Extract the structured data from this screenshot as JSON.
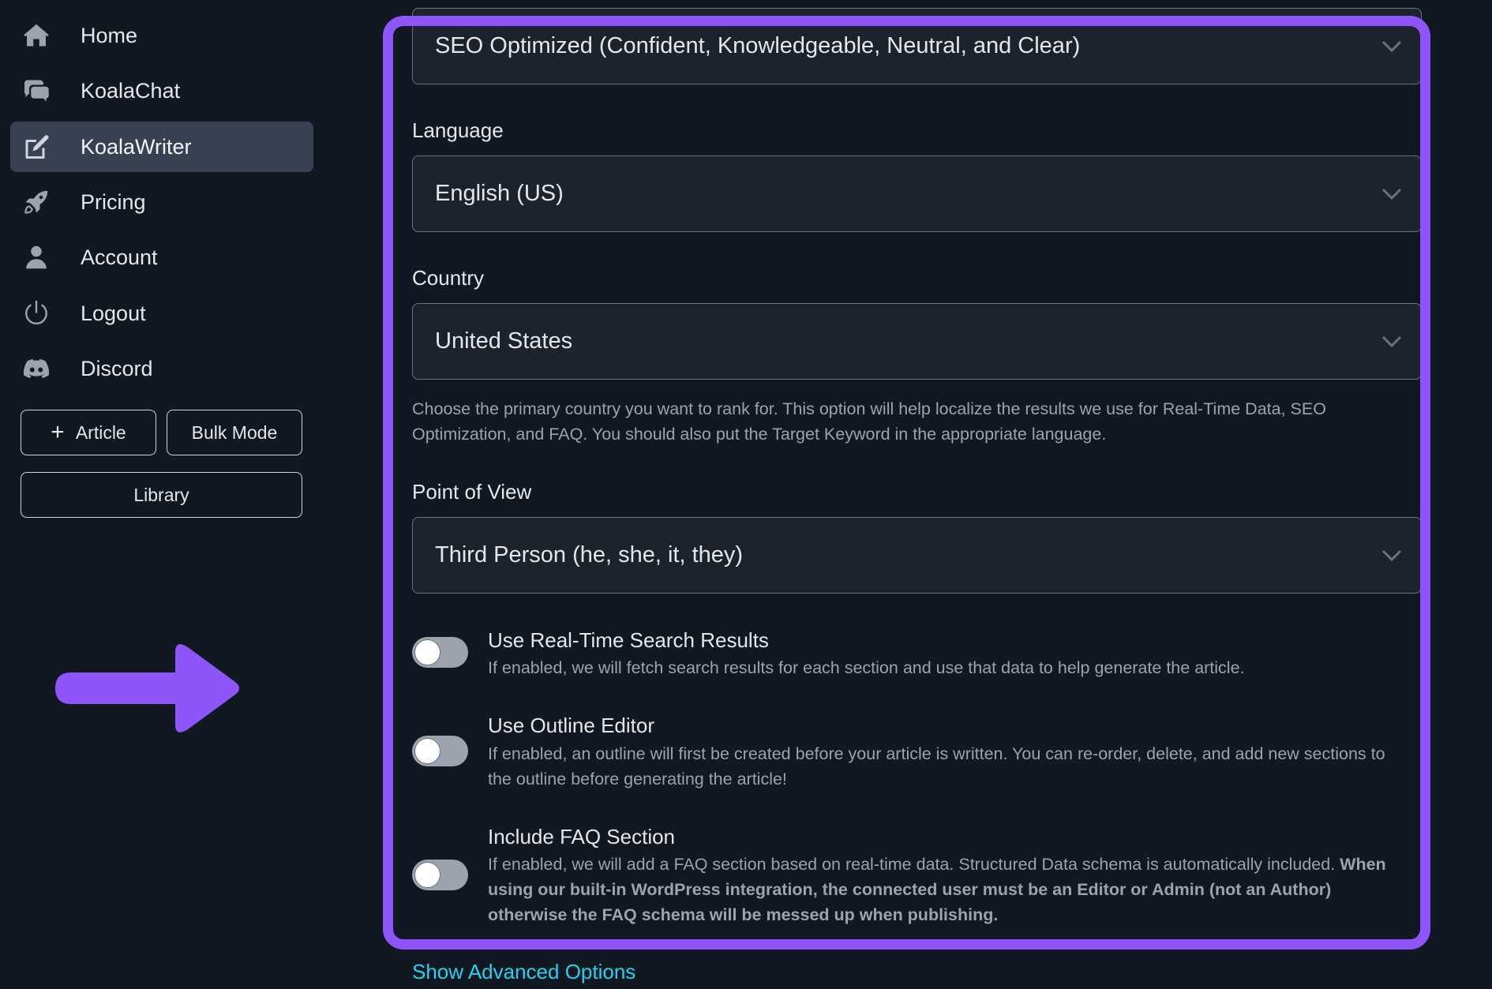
{
  "sidebar": {
    "items": [
      {
        "label": "Home",
        "icon": "home-icon"
      },
      {
        "label": "KoalaChat",
        "icon": "chat-bubbles-icon"
      },
      {
        "label": "KoalaWriter",
        "icon": "edit-icon",
        "active": true
      },
      {
        "label": "Pricing",
        "icon": "rocket-icon"
      },
      {
        "label": "Account",
        "icon": "user-icon"
      },
      {
        "label": "Logout",
        "icon": "power-icon"
      },
      {
        "label": "Discord",
        "icon": "discord-icon"
      }
    ],
    "buttons": {
      "article": "Article",
      "article_icon": "+",
      "bulk_mode": "Bulk Mode",
      "library": "Library"
    }
  },
  "annotation": {
    "arrow_color": "#8E55FA",
    "frame_color": "#8E55FA"
  },
  "form": {
    "tone": {
      "value": "SEO Optimized (Confident, Knowledgeable, Neutral, and Clear)"
    },
    "language": {
      "label": "Language",
      "value": "English (US)"
    },
    "country": {
      "label": "Country",
      "value": "United States",
      "help": "Choose the primary country you want to rank for. This option will help localize the results we use for Real-Time Data, SEO Optimization, and FAQ. You should also put the Target Keyword in the appropriate language."
    },
    "point_of_view": {
      "label": "Point of View",
      "value": "Third Person (he, she, it, they)"
    },
    "options": [
      {
        "title": "Use Real-Time Search Results",
        "description": "If enabled, we will fetch search results for each section and use that data to help generate the article.",
        "enabled": false
      },
      {
        "title": "Use Outline Editor",
        "description": "If enabled, an outline will first be created before your article is written. You can re-order, delete, and add new sections to the outline before generating the article!",
        "enabled": false
      },
      {
        "title": "Include FAQ Section",
        "description": "If enabled, we will add a FAQ section based on real-time data. Structured Data schema is automatically included.",
        "description_bold": "When using our built-in WordPress integration, the connected user must be an Editor or Admin (not an Author) otherwise the FAQ schema will be messed up when publishing.",
        "enabled": false
      }
    ],
    "advanced_link": "Show Advanced Options",
    "link_color": "#22D3EE"
  }
}
